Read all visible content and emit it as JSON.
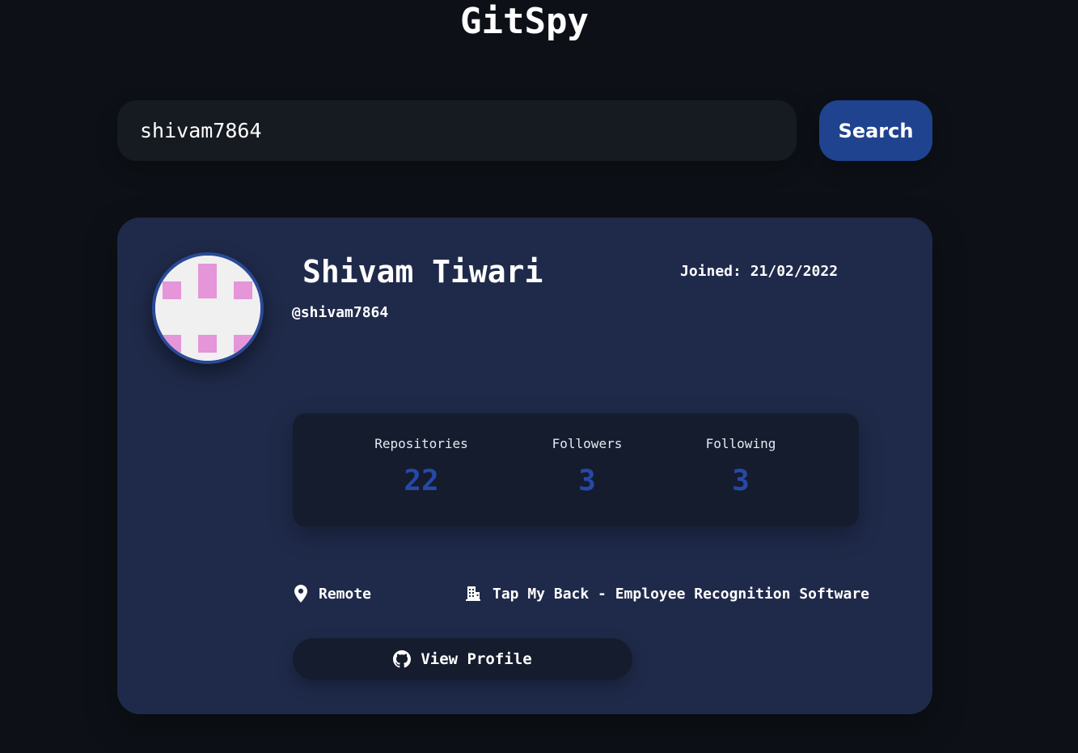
{
  "app": {
    "title": "GitSpy"
  },
  "search": {
    "value": "shivam7864",
    "button_label": "Search"
  },
  "profile": {
    "name": "Shivam Tiwari",
    "handle": "@shivam7864",
    "joined": "Joined: 21/02/2022",
    "avatar_icon": "identicon-avatar",
    "stats": [
      {
        "label": "Repositories",
        "value": "22"
      },
      {
        "label": "Followers",
        "value": "3"
      },
      {
        "label": "Following",
        "value": "3"
      }
    ],
    "location": {
      "icon": "map-pin-icon",
      "text": "Remote"
    },
    "company": {
      "icon": "building-icon",
      "text": "Tap My Back - Employee Recognition Software"
    },
    "view_profile": {
      "icon": "github-icon",
      "label": "View Profile"
    }
  },
  "colors": {
    "background": "#0d1117",
    "card": "#1f2a4a",
    "panel": "#151c2e",
    "accent": "#1f438f",
    "stat_value": "#2649a8",
    "identicon": "#e496d8"
  }
}
